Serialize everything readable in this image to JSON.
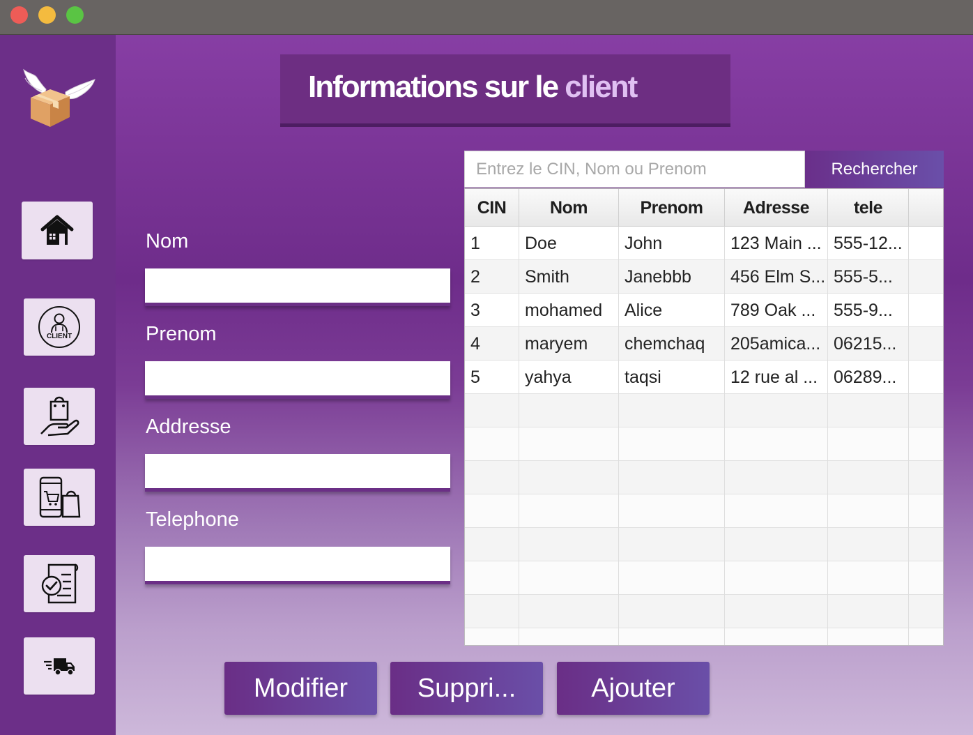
{
  "window": {
    "controls": [
      "close",
      "minimize",
      "maximize"
    ]
  },
  "sidebar": {
    "logo_icon": "flying-package-logo",
    "items": [
      {
        "name": "home",
        "icon": "home-icon"
      },
      {
        "name": "client",
        "icon": "client-icon",
        "icon_text": "CLIENT"
      },
      {
        "name": "orders",
        "icon": "hand-bag-icon"
      },
      {
        "name": "shop",
        "icon": "mobile-shopping-icon"
      },
      {
        "name": "checklist",
        "icon": "checklist-icon"
      },
      {
        "name": "delivery",
        "icon": "delivery-truck-icon"
      }
    ]
  },
  "header": {
    "title_main": "Informations sur le ",
    "title_accent": "client"
  },
  "form": {
    "nom_label": "Nom",
    "prenom_label": "Prenom",
    "adresse_label": "Addresse",
    "telephone_label": "Telephone",
    "nom_value": "",
    "prenom_value": "",
    "adresse_value": "",
    "telephone_value": ""
  },
  "search": {
    "placeholder": "Entrez le CIN, Nom ou Prenom",
    "value": "",
    "button_label": "Rechercher"
  },
  "table": {
    "columns": [
      "CIN",
      "Nom",
      "Prenom",
      "Adresse",
      "tele"
    ],
    "rows": [
      [
        "1",
        "Doe",
        "John",
        "123 Main ...",
        "555-12..."
      ],
      [
        "2",
        "Smith",
        "Janebbb",
        "456 Elm S...",
        "555-5..."
      ],
      [
        "3",
        "mohamed",
        "Alice",
        "789 Oak ...",
        "555-9..."
      ],
      [
        "4",
        "maryem",
        "chemchaq",
        "205amica...",
        "06215..."
      ],
      [
        "5",
        "yahya",
        "taqsi",
        "12 rue al ...",
        "06289..."
      ]
    ]
  },
  "actions": {
    "modifier": "Modifier",
    "supprimer": "Suppri...",
    "ajouter": "Ajouter"
  },
  "colors": {
    "sidebar": "#6c2f88",
    "accent": "#6a2e86",
    "title_accent": "#e0c0f2",
    "titlebar": "#686462"
  }
}
